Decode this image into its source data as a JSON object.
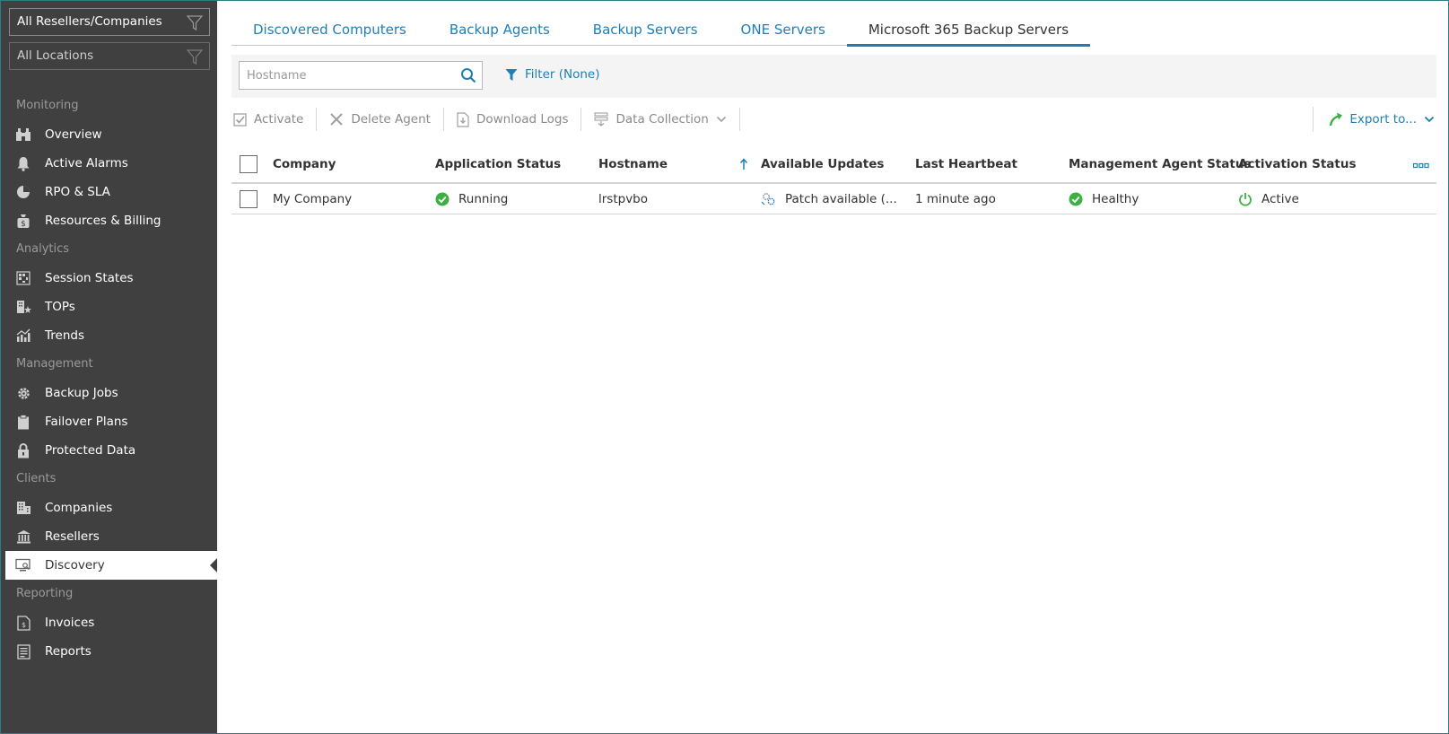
{
  "sidebar": {
    "scope_company": "All Resellers/Companies",
    "scope_location": "All Locations",
    "sections": {
      "monitoring": "Monitoring",
      "analytics": "Analytics",
      "management": "Management",
      "clients": "Clients",
      "reporting": "Reporting"
    },
    "items": {
      "overview": "Overview",
      "active_alarms": "Active Alarms",
      "rpo_sla": "RPO & SLA",
      "resources_billing": "Resources & Billing",
      "session_states": "Session States",
      "tops": "TOPs",
      "trends": "Trends",
      "backup_jobs": "Backup Jobs",
      "failover_plans": "Failover Plans",
      "protected_data": "Protected Data",
      "companies": "Companies",
      "resellers": "Resellers",
      "discovery": "Discovery",
      "invoices": "Invoices",
      "reports": "Reports"
    }
  },
  "tabs": [
    {
      "label": "Discovered Computers"
    },
    {
      "label": "Backup Agents"
    },
    {
      "label": "Backup Servers"
    },
    {
      "label": "ONE Servers"
    },
    {
      "label": "Microsoft 365 Backup Servers"
    }
  ],
  "search": {
    "placeholder": "Hostname"
  },
  "filter": {
    "label": "Filter (None)"
  },
  "toolbar": {
    "activate": "Activate",
    "delete_agent": "Delete Agent",
    "download_logs": "Download Logs",
    "data_collection": "Data Collection",
    "export": "Export to..."
  },
  "table": {
    "columns": {
      "company": "Company",
      "app_status": "Application Status",
      "hostname": "Hostname",
      "updates": "Available Updates",
      "heartbeat": "Last Heartbeat",
      "mgmt_status": "Management Agent Status",
      "activation": "Activation Status"
    },
    "rows": [
      {
        "company": "My Company",
        "app_status": "Running",
        "hostname": "lrstpvbo",
        "updates": "Patch available (...",
        "heartbeat": "1 minute ago",
        "mgmt_status": "Healthy",
        "activation": "Active"
      }
    ]
  },
  "colors": {
    "accent": "#1f7fb5",
    "sidebar_bg": "#404040",
    "success": "#3cb043"
  }
}
